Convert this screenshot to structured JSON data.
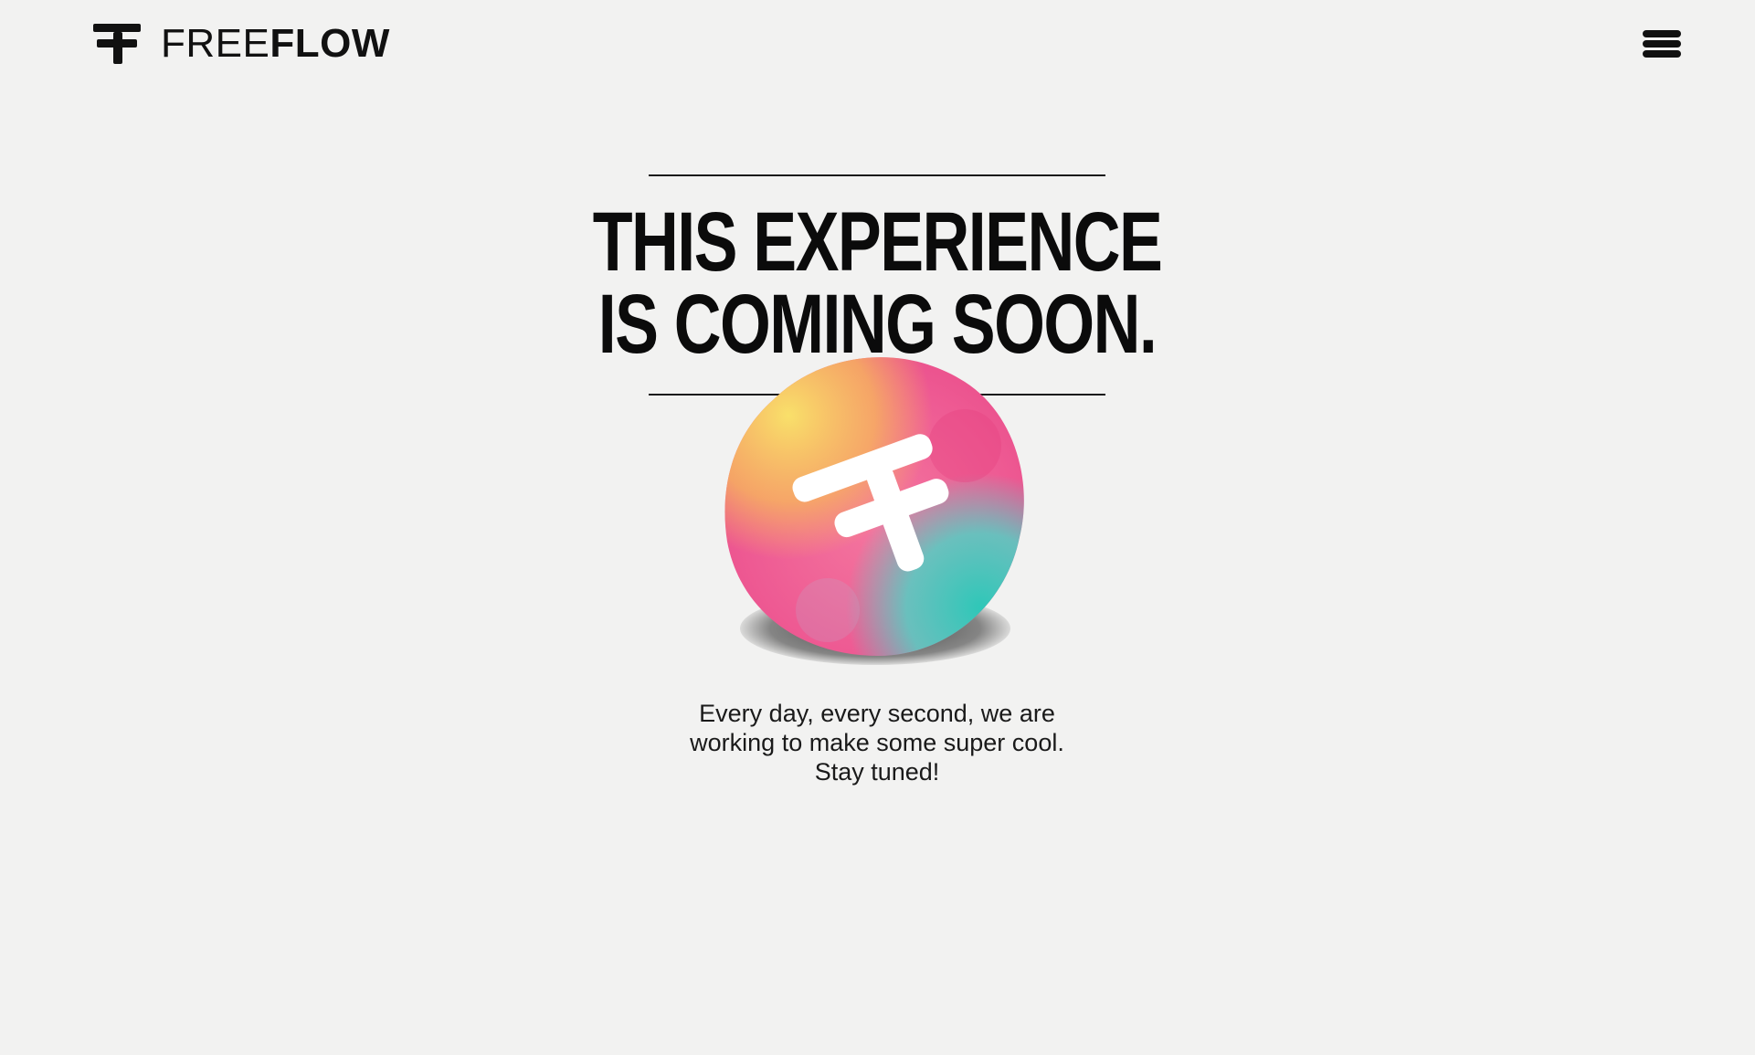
{
  "header": {
    "brand_light": "FREE",
    "brand_bold": "FLOW",
    "logo_icon": "freeflow-logo-icon",
    "menu_icon": "hamburger-menu-icon"
  },
  "hero": {
    "headline_line1": "THIS EXPERIENCE",
    "headline_line2": "IS COMING SOON.",
    "badge_icon": "freeflow-watercolor-badge-icon"
  },
  "message": {
    "line1": "Every day, every second, we are",
    "line2": "working to make some super cool.",
    "line3": "Stay tuned!"
  },
  "colors": {
    "background": "#f2f2f1",
    "text": "#111111",
    "badge_yellow": "#f7d14c",
    "badge_pink": "#f0609b",
    "badge_teal": "#3ec9bd"
  }
}
